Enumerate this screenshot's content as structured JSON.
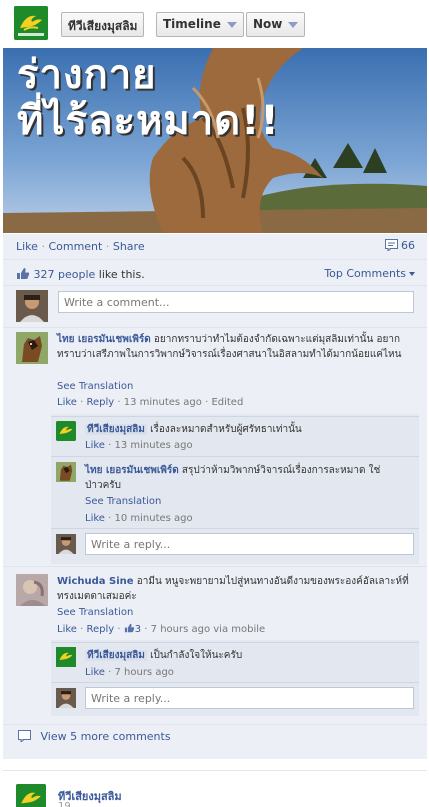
{
  "header": {
    "page_name": "ทีวีเสียงมุสลิม",
    "timeline": "Timeline",
    "now": "Now"
  },
  "photo": {
    "line1": "ร่างกาย",
    "line2": "ที่ไร้ละหมาด!!"
  },
  "actions": {
    "like": "Like",
    "comment": "Comment",
    "share": "Share",
    "comment_count": "66"
  },
  "likes": {
    "people": "327 people",
    "suffix": "like this.",
    "top_comments": "Top Comments"
  },
  "composer": {
    "placeholder": "Write a comment..."
  },
  "comments": [
    {
      "author": "ไทย เยอรมันเชพเพิร์ด",
      "text": "อยากทราบว่าทำไมต้องจำกัดเฉพาะแต่มุสลิมเท่านั้น อยากทราบว่าเสรีภาพในการวิพากษ์วิจารณ์เรื่องศาสนาในอิสลามทำได้มากน้อยแค่ไหน",
      "see_translation": "See Translation",
      "like": "Like",
      "reply": "Reply",
      "time": "13 minutes ago",
      "edited": "Edited",
      "replies": [
        {
          "author": "ทีวีเสียงมุสลิม",
          "text": "เรื่องละหมาดสำหรับผู้ศรัทธาเท่านั้น",
          "like": "Like",
          "time": "13 minutes ago"
        },
        {
          "author": "ไทย เยอรมันเชพเพิร์ด",
          "text": "สรุปว่าห้ามวิพากษ์วิจารณ์เรื่องการละหมาด ใช่ป่าวครับ",
          "see_translation": "See Translation",
          "like": "Like",
          "time": "10 minutes ago"
        }
      ],
      "reply_placeholder": "Write a reply..."
    },
    {
      "author": "Wichuda Sine",
      "text": "อามีน หนูจะพยายามไปสู่หนทางอันดีงามของพระองค์อัลเลาะห์ที่ทรงเมตตาเสมอค่ะ",
      "see_translation": "See Translation",
      "like": "Like",
      "reply": "Reply",
      "like_count": "3",
      "time": "7 hours ago via mobile",
      "replies": [
        {
          "author": "ทีวีเสียงมุสลิม",
          "text": "เป็นกำลังใจให้นะครับ",
          "like": "Like",
          "time": "7 hours ago"
        }
      ],
      "reply_placeholder": "Write a reply..."
    }
  ],
  "view_more": "View 5 more comments",
  "next_post": {
    "author": "ทีวีเสียงมุสลิม",
    "time": "19"
  },
  "colors": {
    "link": "#3b5998",
    "ufi_bg": "#eceff5",
    "logo_green": "#1e8a2a"
  }
}
